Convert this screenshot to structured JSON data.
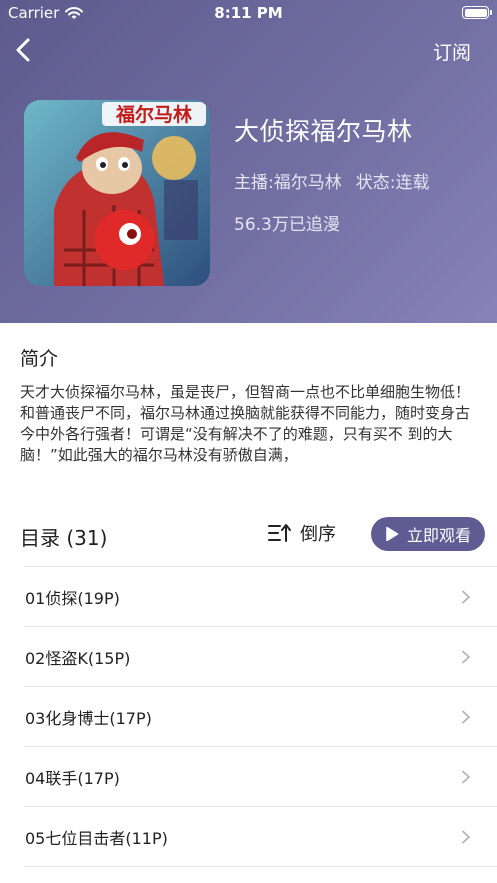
{
  "status_bar": {
    "carrier": "Carrier",
    "time": "8:11 PM"
  },
  "nav": {
    "back_icon": "chevron-left-icon",
    "subscribe_label": "订阅"
  },
  "comic": {
    "cover_title": "福尔马林",
    "title": "大侦探福尔马林",
    "anchor": "主播:福尔马林",
    "status": "状态:连载",
    "follows": "56.3万已追漫"
  },
  "intro": {
    "heading": "简介",
    "text": "天才大侦探福尔马林，虽是丧尸，但智商一点也不比单细胞生物低！和普通丧尸不同，福尔马林通过换脑就能获得不同能力，随时变身古今中外各行强者！可谓是“没有解决不了的难题，只有买不 到的大脑！”如此强大的福尔马林没有骄傲自满，"
  },
  "toc": {
    "heading": "目录 (31)",
    "sort_label": "倒序",
    "watch_label": "立即观看",
    "chapters": [
      {
        "label": "01侦探(19P)"
      },
      {
        "label": "02怪盗K(15P)"
      },
      {
        "label": "03化身博士(17P)"
      },
      {
        "label": "04联手(17P)"
      },
      {
        "label": "05七位目击者(11P)"
      }
    ]
  },
  "colors": {
    "header_start": "#5d5a8e",
    "header_end": "#8783b8",
    "accent": "#5f5c93"
  }
}
